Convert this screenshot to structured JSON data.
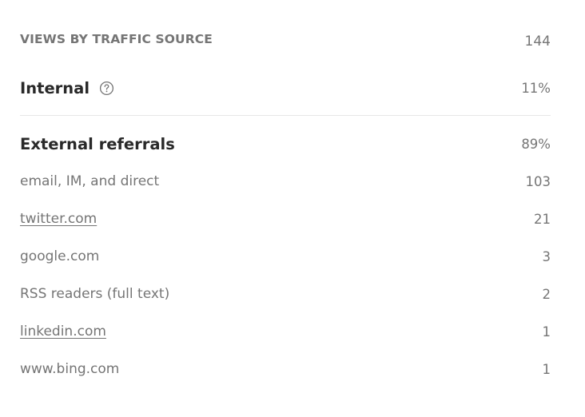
{
  "stats": {
    "heading": {
      "label": "VIEWS BY TRAFFIC SOURCE",
      "total": "144"
    },
    "internal": {
      "label": "Internal",
      "percent": "11%",
      "icon": "help-circle-icon"
    },
    "external": {
      "label": "External referrals",
      "percent": "89%"
    },
    "sources": [
      {
        "label": "email, IM, and direct",
        "count": "103",
        "is_link": false
      },
      {
        "label": "twitter.com",
        "count": "21",
        "is_link": true
      },
      {
        "label": "google.com",
        "count": "3",
        "is_link": false
      },
      {
        "label": "RSS readers (full text)",
        "count": "2",
        "is_link": false
      },
      {
        "label": "linkedin.com",
        "count": "1",
        "is_link": true
      },
      {
        "label": "www.bing.com",
        "count": "1",
        "is_link": false
      }
    ]
  },
  "colors": {
    "text_primary": "#292929",
    "text_muted": "#757575",
    "divider": "#e6e6e6",
    "background": "#ffffff"
  }
}
